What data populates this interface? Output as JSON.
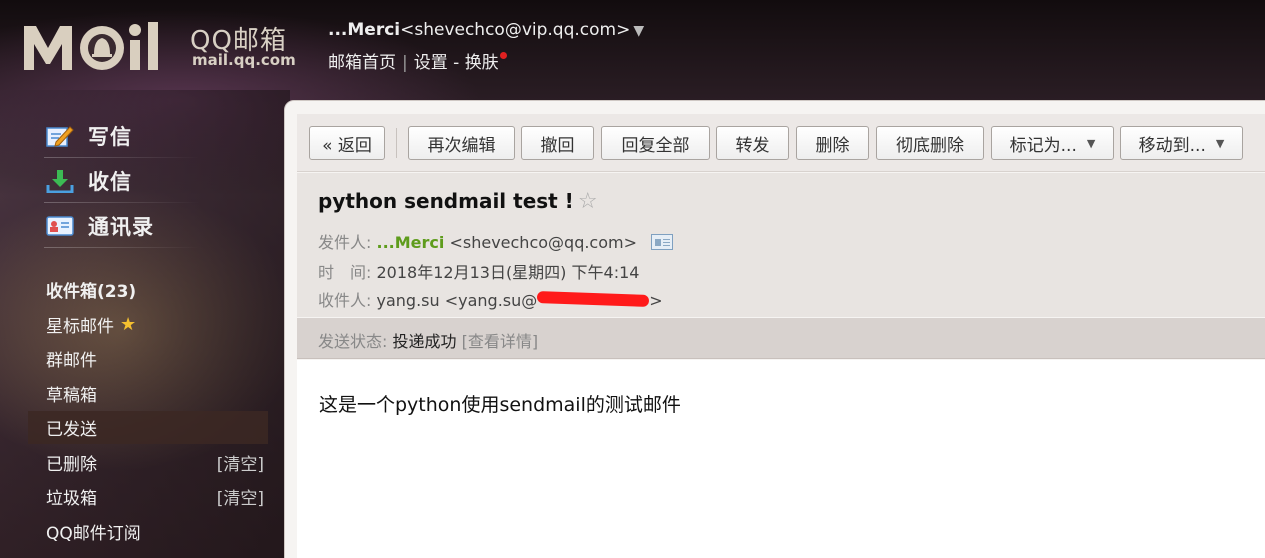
{
  "header": {
    "brand_qq": "QQ邮箱",
    "brand_domain": "mail.qq.com",
    "account_name": "...Merci",
    "account_email": "<shevechco@vip.qq.com>",
    "account_caret": "▼",
    "nav": {
      "home": "邮箱首页",
      "settings": "设置",
      "dash": "-",
      "skin": "换肤"
    }
  },
  "sidebar": {
    "compose": "写信",
    "inbox_check": "收信",
    "contacts": "通讯录",
    "folders": [
      {
        "label": "收件箱(23)",
        "extra": ""
      },
      {
        "label": "星标邮件",
        "extra": ""
      },
      {
        "label": "群邮件",
        "extra": ""
      },
      {
        "label": "草稿箱",
        "extra": ""
      },
      {
        "label": "已发送",
        "extra": ""
      },
      {
        "label": "已删除",
        "extra": "[清空]"
      },
      {
        "label": "垃圾箱",
        "extra": "[清空]"
      },
      {
        "label": "QQ邮件订阅",
        "extra": ""
      }
    ]
  },
  "toolbar": {
    "back": "« 返回",
    "reedit": "再次编辑",
    "recall": "撤回",
    "reply_all": "回复全部",
    "forward": "转发",
    "delete": "删除",
    "perm_delete": "彻底删除",
    "mark_as": "标记为...",
    "move_to": "移动到...",
    "dropdown_arrow": "▼"
  },
  "mail": {
    "subject": "python sendmail test !",
    "star": "☆",
    "from_label": "发件人:",
    "from_name": "...Merci",
    "from_email": "<shevechco@qq.com>",
    "time_label": "时　间:",
    "time_value": "2018年12月13日(星期四) 下午4:14",
    "to_label": "收件人:",
    "to_name": "yang.su",
    "to_email_prefix": "<yang.su@",
    "to_email_suffix": ">",
    "status_label": "发送状态:",
    "status_value": "投递成功",
    "status_link": "[查看详情]",
    "body": "这是一个python使用sendmail的测试邮件"
  },
  "colors": {
    "sender_green": "#5e9c1c",
    "star_gold": "#f5c030",
    "redact_red": "#ff1a1a",
    "notify_dot": "#e02020"
  }
}
